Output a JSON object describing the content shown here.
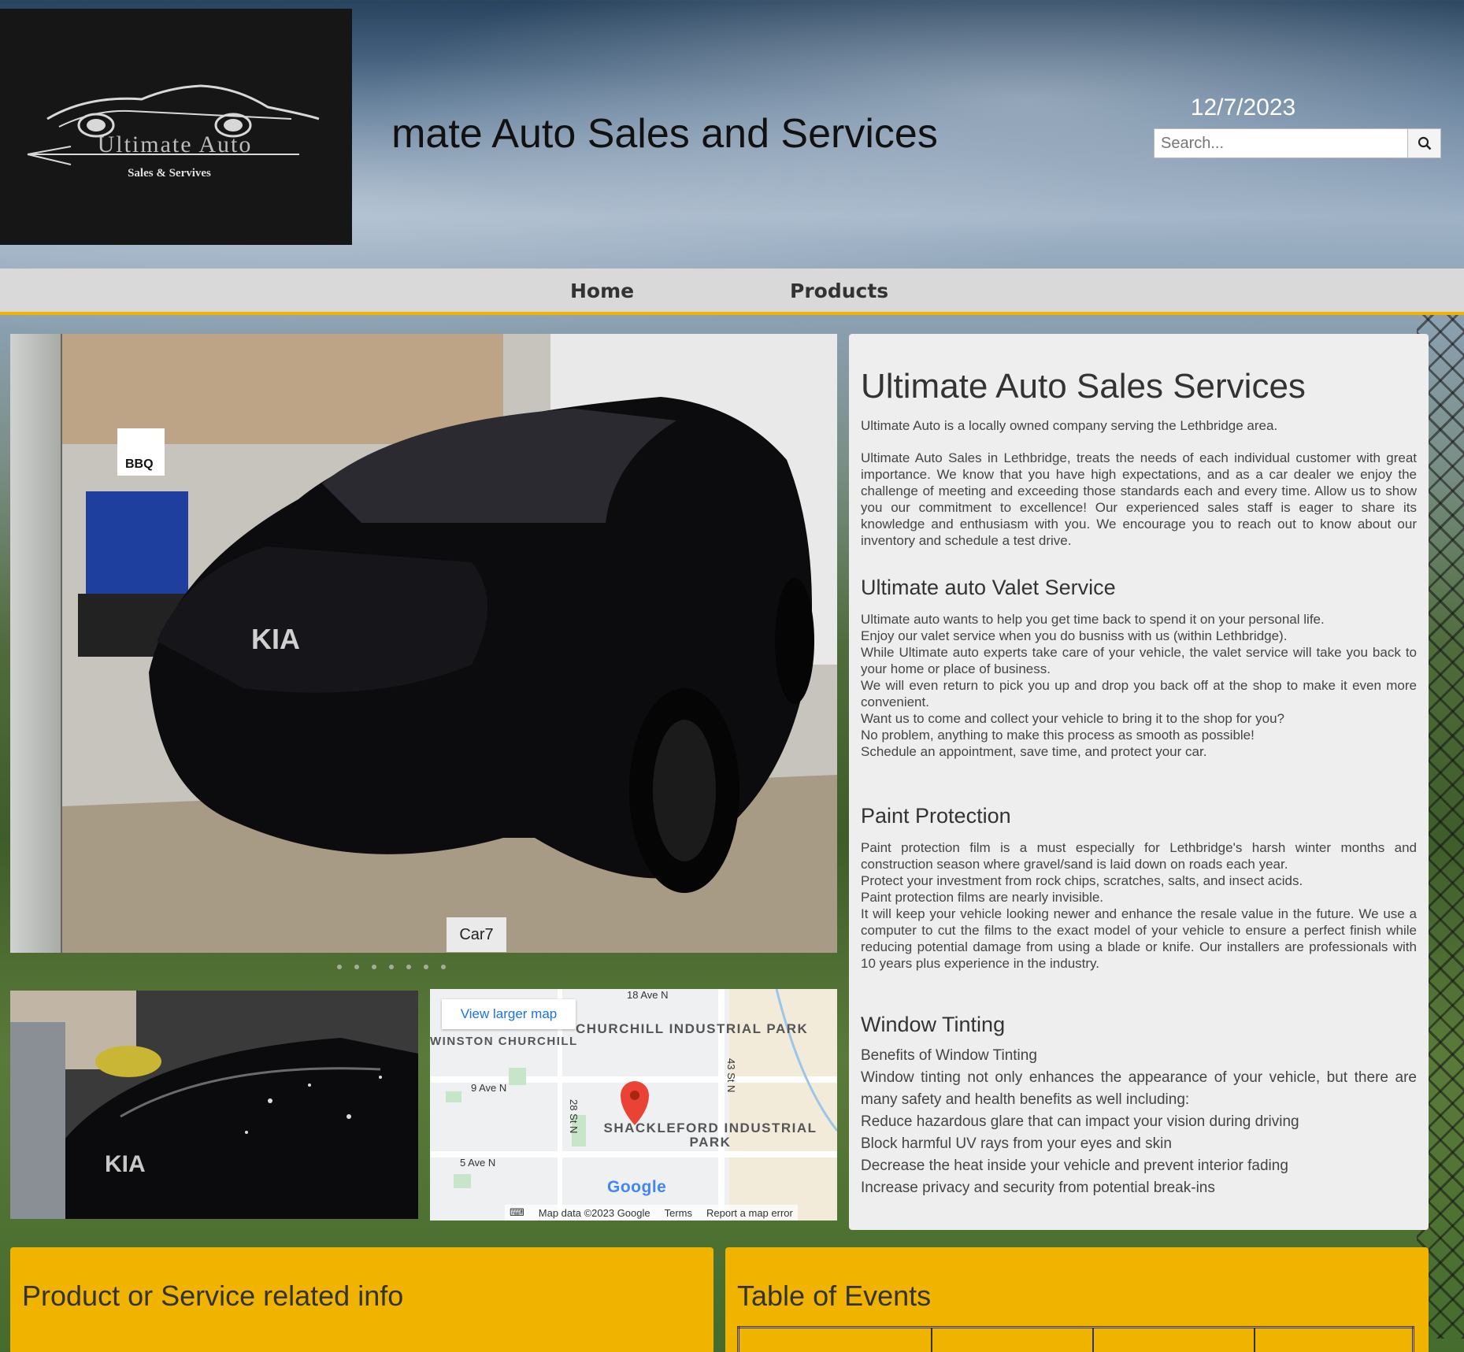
{
  "header": {
    "logo": {
      "brand": "Ultimate Auto",
      "tagline": "Sales & Servives"
    },
    "title": "Ultimate Auto Sales and Services",
    "date": "12/7/2023",
    "search": {
      "placeholder": "Search...",
      "icon": "search-icon"
    }
  },
  "nav": {
    "items": [
      {
        "label": "Home"
      },
      {
        "label": "Products"
      }
    ]
  },
  "slideshow": {
    "caption": "Car7",
    "dot_count": 7
  },
  "map": {
    "view_larger": "View larger map",
    "areas": [
      "CHURCHILL INDUSTRIAL PARK",
      "SHACKLEFORD INDUSTRIAL PARK",
      "WINSTON CHURCHILL"
    ],
    "streets": [
      "18 Ave N",
      "9 Ave N",
      "5 Ave N",
      "28 St N",
      "43 St N"
    ],
    "logo": "Google",
    "footer": [
      "Map data ©2023 Google",
      "Terms",
      "Report a map error"
    ]
  },
  "info": {
    "heading": "Ultimate Auto Sales Services",
    "intro": "Ultimate Auto is a locally owned company serving the Lethbridge area.",
    "about": "Ultimate Auto Sales in Lethbridge, treats the needs of each individual customer with great importance. We know that you have high expectations, and as a car dealer we enjoy the challenge of meeting and exceeding those standards each and every time. Allow us to show you our commitment to excellence! Our experienced sales staff is eager to share its knowledge and enthusiasm with you. We encourage you to reach out to know about our inventory and schedule a test drive.",
    "valet": {
      "heading": "Ultimate auto Valet Service",
      "lines": [
        "Ultimate auto wants to help you get time back to spend it on your personal life.",
        "Enjoy our valet service when you do busniss with us (within Lethbridge).",
        "While Ultimate auto experts take care of your vehicle, the valet service will take you back to your home or place of business.",
        "We will even return to pick you up and drop you back off at the shop to make it even more convenient.",
        "Want us to come and collect your vehicle to bring it to the shop for you?",
        "No problem, anything to make this process as smooth as possible!",
        "Schedule an appointment, save time, and protect your car."
      ]
    },
    "paint": {
      "heading": "Paint Protection",
      "lines": [
        "Paint protection film is a must especially for Lethbridge's harsh winter months and construction season where gravel/sand is laid down on roads each year.",
        "Protect your investment from rock chips, scratches, salts, and insect acids.",
        "Paint protection films are nearly invisible.",
        "It will keep your vehicle looking newer and enhance the resale value in the future. We use a computer to cut the films to the exact model of your vehicle to ensure a perfect finish while reducing potential damage from using a blade or knife. Our installers are professionals with 10 years plus experience in the industry."
      ]
    },
    "tinting": {
      "heading": "Window Tinting",
      "lines": [
        "Benefits of Window Tinting",
        "Window tinting not only enhances the appearance of your vehicle, but there are many safety and health benefits as well including:",
        "Reduce hazardous glare that can impact your vision during driving",
        "Block harmful UV rays from your eyes and skin",
        "Decrease the heat inside your vehicle and prevent interior fading",
        "Increase privacy and security from potential break-ins"
      ]
    }
  },
  "panels": {
    "product_heading": "Product or Service related info",
    "events_heading": "Table of Events"
  },
  "colors": {
    "accent": "#f0b400",
    "nav_bg": "#d9d9d9",
    "panel_bg": "#eeeeee"
  }
}
